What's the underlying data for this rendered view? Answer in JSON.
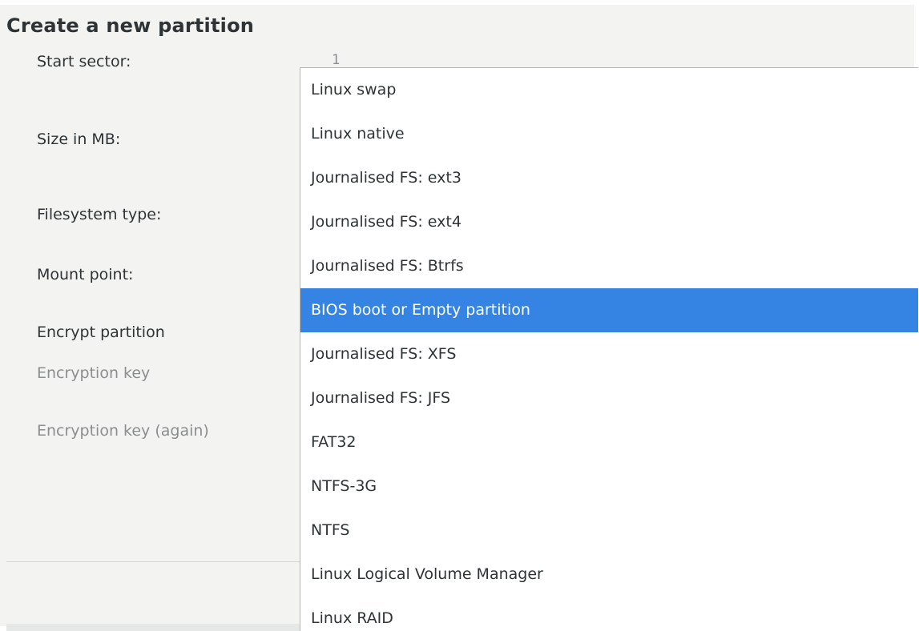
{
  "dialog": {
    "title": "Create a new partition",
    "fields": {
      "start_sector_label": "Start sector:",
      "start_sector_value": "1",
      "size_label": "Size in MB:",
      "fs_type_label": "Filesystem type:",
      "mount_point_label": "Mount point:",
      "encrypt_label": "Encrypt partition",
      "encryption_key_label": "Encryption key",
      "encryption_key_again_label": "Encryption key (again)"
    }
  },
  "dropdown": {
    "selected": "BIOS boot or Empty partition",
    "options": [
      "Linux swap",
      "Linux native",
      "Journalised FS: ext3",
      "Journalised FS: ext4",
      "Journalised FS: Btrfs",
      "BIOS boot or Empty partition",
      "Journalised FS: XFS",
      "Journalised FS: JFS",
      "FAT32",
      "NTFS-3G",
      "NTFS",
      "Linux Logical Volume Manager",
      "Linux RAID"
    ]
  },
  "colors": {
    "selection": "#3584e4",
    "dialog_background": "#f3f3f2",
    "text": "#2e3436",
    "disabled_text": "#8b8e8f"
  }
}
